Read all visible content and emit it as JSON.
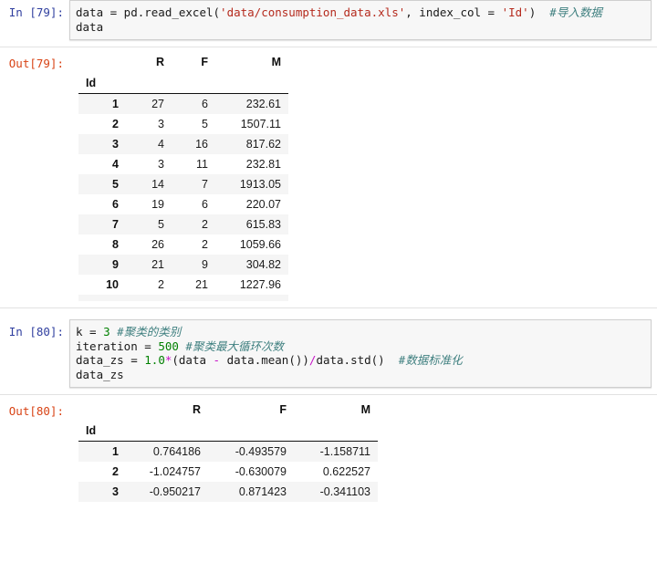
{
  "notebook": {
    "cells": [
      {
        "type": "code",
        "prompt": "In [79]:",
        "source_lines": [
          [
            {
              "t": "plain",
              "v": "data = pd.read_excel("
            },
            {
              "t": "str",
              "v": "'data/consumption_data.xls'"
            },
            {
              "t": "plain",
              "v": ", index_col = "
            },
            {
              "t": "str",
              "v": "'Id'"
            },
            {
              "t": "plain",
              "v": ")  "
            },
            {
              "t": "com",
              "v": "#导入数据"
            }
          ],
          [
            {
              "t": "plain",
              "v": "data"
            }
          ]
        ]
      },
      {
        "type": "output",
        "prompt": "Out[79]:",
        "table": {
          "index_name": "Id",
          "columns": [
            "R",
            "F",
            "M"
          ],
          "index": [
            "1",
            "2",
            "3",
            "4",
            "5",
            "6",
            "7",
            "8",
            "9",
            "10"
          ],
          "rows": [
            [
              "27",
              "6",
              "232.61"
            ],
            [
              "3",
              "5",
              "1507.11"
            ],
            [
              "4",
              "16",
              "817.62"
            ],
            [
              "3",
              "11",
              "232.81"
            ],
            [
              "14",
              "7",
              "1913.05"
            ],
            [
              "19",
              "6",
              "220.07"
            ],
            [
              "5",
              "2",
              "615.83"
            ],
            [
              "26",
              "2",
              "1059.66"
            ],
            [
              "21",
              "9",
              "304.82"
            ],
            [
              "2",
              "21",
              "1227.96"
            ]
          ]
        }
      },
      {
        "type": "code",
        "prompt": "In [80]:",
        "source_lines": [
          [
            {
              "t": "plain",
              "v": "k = "
            },
            {
              "t": "num",
              "v": "3"
            },
            {
              "t": "plain",
              "v": " "
            },
            {
              "t": "com",
              "v": "#聚类的类别"
            }
          ],
          [
            {
              "t": "plain",
              "v": "iteration = "
            },
            {
              "t": "num",
              "v": "500"
            },
            {
              "t": "plain",
              "v": " "
            },
            {
              "t": "com",
              "v": "#聚类最大循环次数"
            }
          ],
          [
            {
              "t": "plain",
              "v": "data_zs = "
            },
            {
              "t": "num",
              "v": "1.0"
            },
            {
              "t": "op",
              "v": "*"
            },
            {
              "t": "plain",
              "v": "(data "
            },
            {
              "t": "op",
              "v": "-"
            },
            {
              "t": "plain",
              "v": " data.mean())"
            },
            {
              "t": "op",
              "v": "/"
            },
            {
              "t": "plain",
              "v": "data.std()  "
            },
            {
              "t": "com",
              "v": "#数据标准化"
            }
          ],
          [
            {
              "t": "plain",
              "v": "data_zs"
            }
          ]
        ]
      },
      {
        "type": "output",
        "prompt": "Out[80]:",
        "table": {
          "index_name": "Id",
          "columns": [
            "R",
            "F",
            "M"
          ],
          "index": [
            "1",
            "2",
            "3"
          ],
          "rows": [
            [
              "0.764186",
              "-0.493579",
              "-1.158711"
            ],
            [
              "-1.024757",
              "-0.630079",
              "0.622527"
            ],
            [
              "-0.950217",
              "0.871423",
              "-0.341103"
            ]
          ]
        }
      }
    ]
  },
  "colors": {
    "prompt_in": "#303f9f",
    "prompt_out": "#d84315",
    "string": "#b52a1d",
    "number": "#008000",
    "operator": "#c813c8",
    "comment": "#408080",
    "cell_bg": "#f7f7f7",
    "cell_border": "#cfcfcf",
    "row_stripe": "#f5f5f5"
  }
}
